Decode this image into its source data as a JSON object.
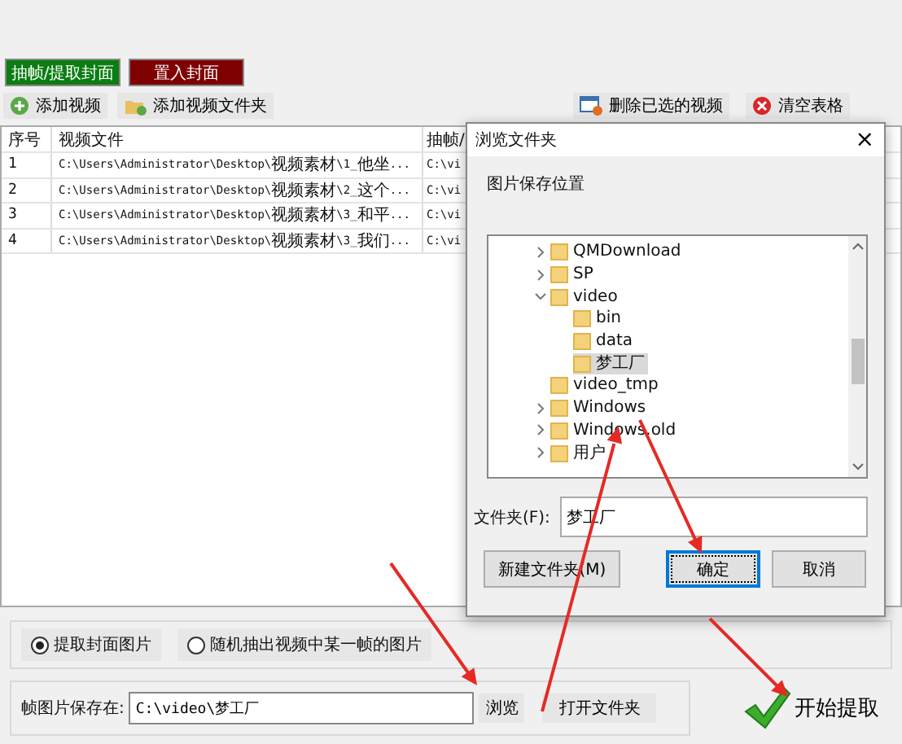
{
  "top_buttons": [
    {
      "label": "抽帧/提取封面",
      "kind": "green"
    },
    {
      "label": "置入封面",
      "kind": "red"
    }
  ],
  "toolbar": [
    {
      "label": "添加视频",
      "kind": "add"
    },
    {
      "label": "添加视频文件夹",
      "kind": "folder"
    },
    {
      "label": "删除已选的视频",
      "kind": "delete"
    },
    {
      "label": "清空表格",
      "kind": "clear"
    }
  ],
  "table": {
    "columns": [
      "序号",
      "视频文件",
      "抽帧/"
    ],
    "rows": [
      [
        "1",
        "C:\\Users\\Administrator\\Desktop\\视频素材\\1_他坐...",
        "C:\\vi"
      ],
      [
        "2",
        "C:\\Users\\Administrator\\Desktop\\视频素材\\2_这个...",
        "C:\\vi"
      ],
      [
        "3",
        "C:\\Users\\Administrator\\Desktop\\视频素材\\3_和平...",
        "C:\\vi"
      ],
      [
        "4",
        "C:\\Users\\Administrator\\Desktop\\视频素材\\3_我们...",
        "C:\\vi"
      ]
    ]
  },
  "options": [
    {
      "label": "提取封面图片",
      "selected": true
    },
    {
      "label": "随机抽出视频中某一帧的图片",
      "selected": false
    }
  ],
  "save": {
    "label": "帧图片保存在:",
    "value": "C:\\video\\梦工厂",
    "browse": "浏览",
    "open": "打开文件夹",
    "start": "开始提取"
  },
  "dialog": {
    "title": "浏览文件夹",
    "close": "×",
    "prompt": "图片保存位置",
    "tree": [
      {
        "label": "QMDownload",
        "expanded": false,
        "selected": false
      },
      {
        "label": "SP",
        "expanded": false,
        "selected": false
      },
      {
        "label": "video",
        "expanded": true,
        "selected": false,
        "children": [
          {
            "label": "bin",
            "selected": false
          },
          {
            "label": "data",
            "selected": false
          },
          {
            "label": "梦工厂",
            "selected": true
          }
        ]
      },
      {
        "label": "video_tmp",
        "selected": false
      },
      {
        "label": "Windows",
        "expanded": false,
        "selected": false
      },
      {
        "label": "Windows.old",
        "expanded": false,
        "selected": false
      },
      {
        "label": "用户",
        "expanded": false,
        "selected": false
      }
    ],
    "folder_label": "文件夹(F):",
    "folder_value": "梦工厂",
    "buttons": [
      {
        "label": "新建文件夹(M)",
        "focused": false
      },
      {
        "label": "确定",
        "focused": true
      },
      {
        "label": "取消",
        "focused": false
      }
    ]
  }
}
